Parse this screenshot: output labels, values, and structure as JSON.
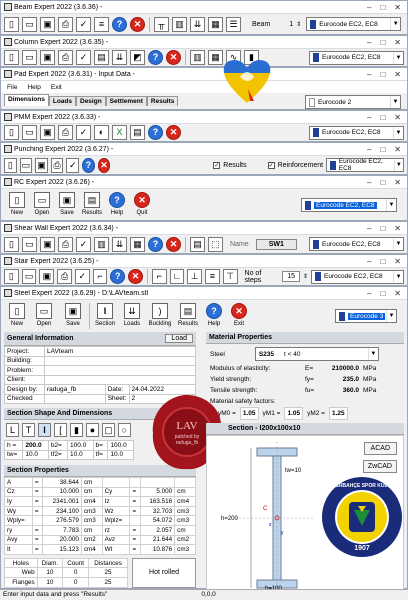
{
  "windows": {
    "beam": {
      "title": "Beam Expert 2022 (3.6.36) -",
      "field_label": "Beam",
      "field_value": "1",
      "code": "Eurocode EC2, EC8"
    },
    "column": {
      "title": "Column Expert 2022 (3.6.35) -",
      "code": "Eurocode EC2, EC8"
    },
    "pad": {
      "title": "Pad Expert 2022 (3.6.31) - Input Data -",
      "menu": [
        "File",
        "Help",
        "Exit"
      ],
      "tabs": [
        "Dimensions",
        "Loads",
        "Design",
        "Settlement",
        "Results"
      ],
      "code": "Eurocode 2"
    },
    "pmm": {
      "title": "PMM Expert 2022 (3.6.33) -",
      "code": "Eurocode EC2, EC8"
    },
    "punching": {
      "title": "Punching Expert 2022 (3.6.27) -",
      "check_results": "Results",
      "check_reinforcement": "Reinforcement",
      "code": "Eurocode EC2, EC8"
    },
    "rc": {
      "title": "RC Expert 2022 (3.6.26) -",
      "buttons": [
        "New",
        "Open",
        "Save",
        "Results",
        "Help",
        "Quit"
      ],
      "code": "Eurocode EC2, EC8"
    },
    "shearwall": {
      "title": "Shear Wall Expert 2022 (3.6.34) -",
      "name_label": "Name",
      "name_value": "SW1",
      "code": "Eurocode EC2, EC8"
    },
    "stair": {
      "title": "Stair Expert 2022 (3.6.25) -",
      "steps_label": "No of steps",
      "steps_value": "15",
      "code": "Eurocode EC2, EC8"
    }
  },
  "steel": {
    "title": "Steel Expert 2022 (3.6.29) - D:\\LAVteam.stl",
    "buttons": [
      "New",
      "Open",
      "Save",
      "Section",
      "Loads",
      "Buckling",
      "Results",
      "Help",
      "Exit"
    ],
    "code": "Eurocode 3",
    "general": {
      "header": "General Information",
      "load_btn": "Load",
      "rows": [
        {
          "k": "Project:",
          "v": "LAVteam"
        },
        {
          "k": "Building:",
          "v": ""
        },
        {
          "k": "Problem:",
          "v": ""
        },
        {
          "k": "Client:",
          "v": ""
        }
      ],
      "design_by_label": "Design by:",
      "design_by": "raduga_fb",
      "date_label": "Date:",
      "date": "24.04.2022",
      "checked_label": "Checked",
      "sheet_label": "Sheet:",
      "sheet": "2"
    },
    "shape_header": "Section Shape And Dimensions",
    "dims": {
      "h_label": "h =",
      "h": "200.0",
      "b2_label": "b2=",
      "b2": "100.0",
      "b_label": "b=",
      "b": "100.0",
      "tw_label": "tw=",
      "tw": "10.0",
      "tf2_label": "tf2=",
      "tf2": "10.0",
      "tf_label": "tf=",
      "tf": "10.0"
    },
    "props_header": "Section Properties",
    "props": [
      [
        "A",
        "=",
        "38.644",
        "cm",
        "",
        "",
        "",
        ""
      ],
      [
        "Cz",
        "=",
        "10.000",
        "cm",
        "Cy",
        "=",
        "5.000",
        "cm"
      ],
      [
        "Iy",
        "=",
        "2341.001",
        "cm4",
        "Iz",
        "=",
        "163.516",
        "cm4"
      ],
      [
        "Wy",
        "=",
        "234.100",
        "cm3",
        "Wz",
        "=",
        "32.703",
        "cm3"
      ],
      [
        "Wply=",
        "",
        "276.579",
        "cm3",
        "Wplz=",
        "",
        "54.072",
        "cm3"
      ],
      [
        "ry",
        "=",
        "7.783",
        "cm",
        "rz",
        "=",
        "2.057",
        "cm"
      ],
      [
        "Avy",
        "=",
        "20.000",
        "cm2",
        "Avz",
        "=",
        "21.644",
        "cm2"
      ],
      [
        "It",
        "=",
        "15.123",
        "cm4",
        "Wt",
        "=",
        "10.876",
        "cm3"
      ]
    ],
    "holes": {
      "headers": [
        "Holes",
        "Diam.",
        "Count",
        "Distances"
      ],
      "rows": [
        [
          "Web",
          "10",
          "0",
          "25"
        ],
        [
          "Flanges",
          "10",
          "0",
          "25"
        ]
      ]
    },
    "hot_rolled": "Hot rolled",
    "material": {
      "header": "Material Properties",
      "steel_label": "Steel",
      "steel_value": "S235",
      "t_value": "t < 40",
      "mod_label": "Modulus of elasticity:",
      "mod_sym": "E=",
      "mod_val": "210000.0",
      "mod_unit": "MPa",
      "yield_label": "Yield strength:",
      "yield_sym": "fy=",
      "yield_val": "235.0",
      "yield_unit": "MPa",
      "tensile_label": "Tensile strength:",
      "tensile_sym": "fu=",
      "tensile_val": "360.0",
      "tensile_unit": "MPa",
      "safety_label": "Material safety factors:",
      "gm0": "1.05",
      "gm1": "1.05",
      "gm2": "1.25",
      "gm0_label": "γM0 =",
      "gm1_label": "γM1 =",
      "gm2_label": "γM2 ="
    },
    "section": {
      "header": "Section - I200x100x10",
      "acad": "ACAD",
      "zwcad": "ZwCAD",
      "tw_label": "tw=10",
      "h_label": "h=200",
      "b_label": "b=100",
      "c_label": "C",
      "z_label": "z",
      "y_label": "y"
    },
    "badge": {
      "text1": "FENERBAHÇE SPOR KULÜBÜ",
      "year": "1907"
    },
    "seal": {
      "line1": "LAV",
      "line2": "patched by",
      "line3": "raduga_fb"
    },
    "status": "Enter input data and press \"Results\"",
    "status_coord": "0,0,0"
  }
}
